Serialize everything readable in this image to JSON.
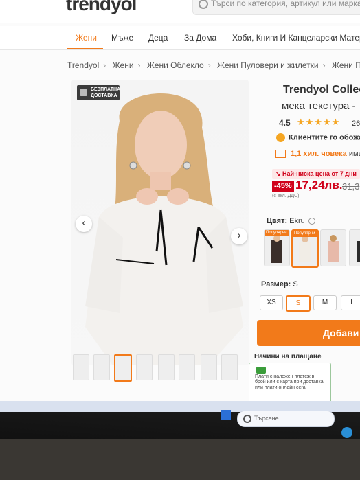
{
  "site": {
    "logo": "trendyol",
    "search_placeholder": "Търси по категория, артикул или марка"
  },
  "nav": {
    "items": [
      "Жени",
      "Мъже",
      "Деца",
      "За Дома",
      "Хоби, Книги И Канцеларски Матери"
    ],
    "active": "Жени"
  },
  "breadcrumb": [
    "Trendyol",
    "Жени",
    "Жени Облекло",
    "Жени Пуловери и жилетки",
    "Жени Пул"
  ],
  "gallery": {
    "badge_line1": "БЕЗПЛАТНА",
    "badge_line2": "ДОСТАВКА",
    "prev_arrow": "‹",
    "next_arrow": "›",
    "thumbnail_count": 8,
    "selected_thumbnail": 3
  },
  "product": {
    "title": "Trendyol Collec",
    "subtitle": "мека текстура -",
    "rating": "4.5",
    "stars": "★★★★★",
    "reviews": "26",
    "favorite_text": "Клиентите го обожа",
    "views_count": "1,1 хил. човека",
    "views_suffix": " има",
    "lowest_price_label": "↘ Най-ниска цена от 7 дни",
    "discount": "-45%",
    "price": "17,24лв.",
    "old_price": "31,3",
    "vat_note": "(с вкл. ДДС)"
  },
  "color": {
    "label": "Цвят:",
    "value": " Ekru",
    "swatch_tag": "Популярни",
    "swatches": [
      "#3a2e2a",
      "#f1ede6",
      "#e7b9a9",
      "#2b2b2b"
    ]
  },
  "size": {
    "label": "Размер:",
    "value": " S",
    "options": [
      "XS",
      "S",
      "M",
      "L"
    ],
    "selected": "S"
  },
  "actions": {
    "add_to_cart": "Добави в"
  },
  "payment": {
    "title": "Начини на плащане",
    "text": "Плати с наложен платеж в брой или с карта при доставка, или плати онлайн сега."
  },
  "taskbar": {
    "search_placeholder": "Търсене"
  },
  "colors": {
    "accent": "#f27a1a",
    "price_red": "#d0021b",
    "star": "#f5a623"
  }
}
